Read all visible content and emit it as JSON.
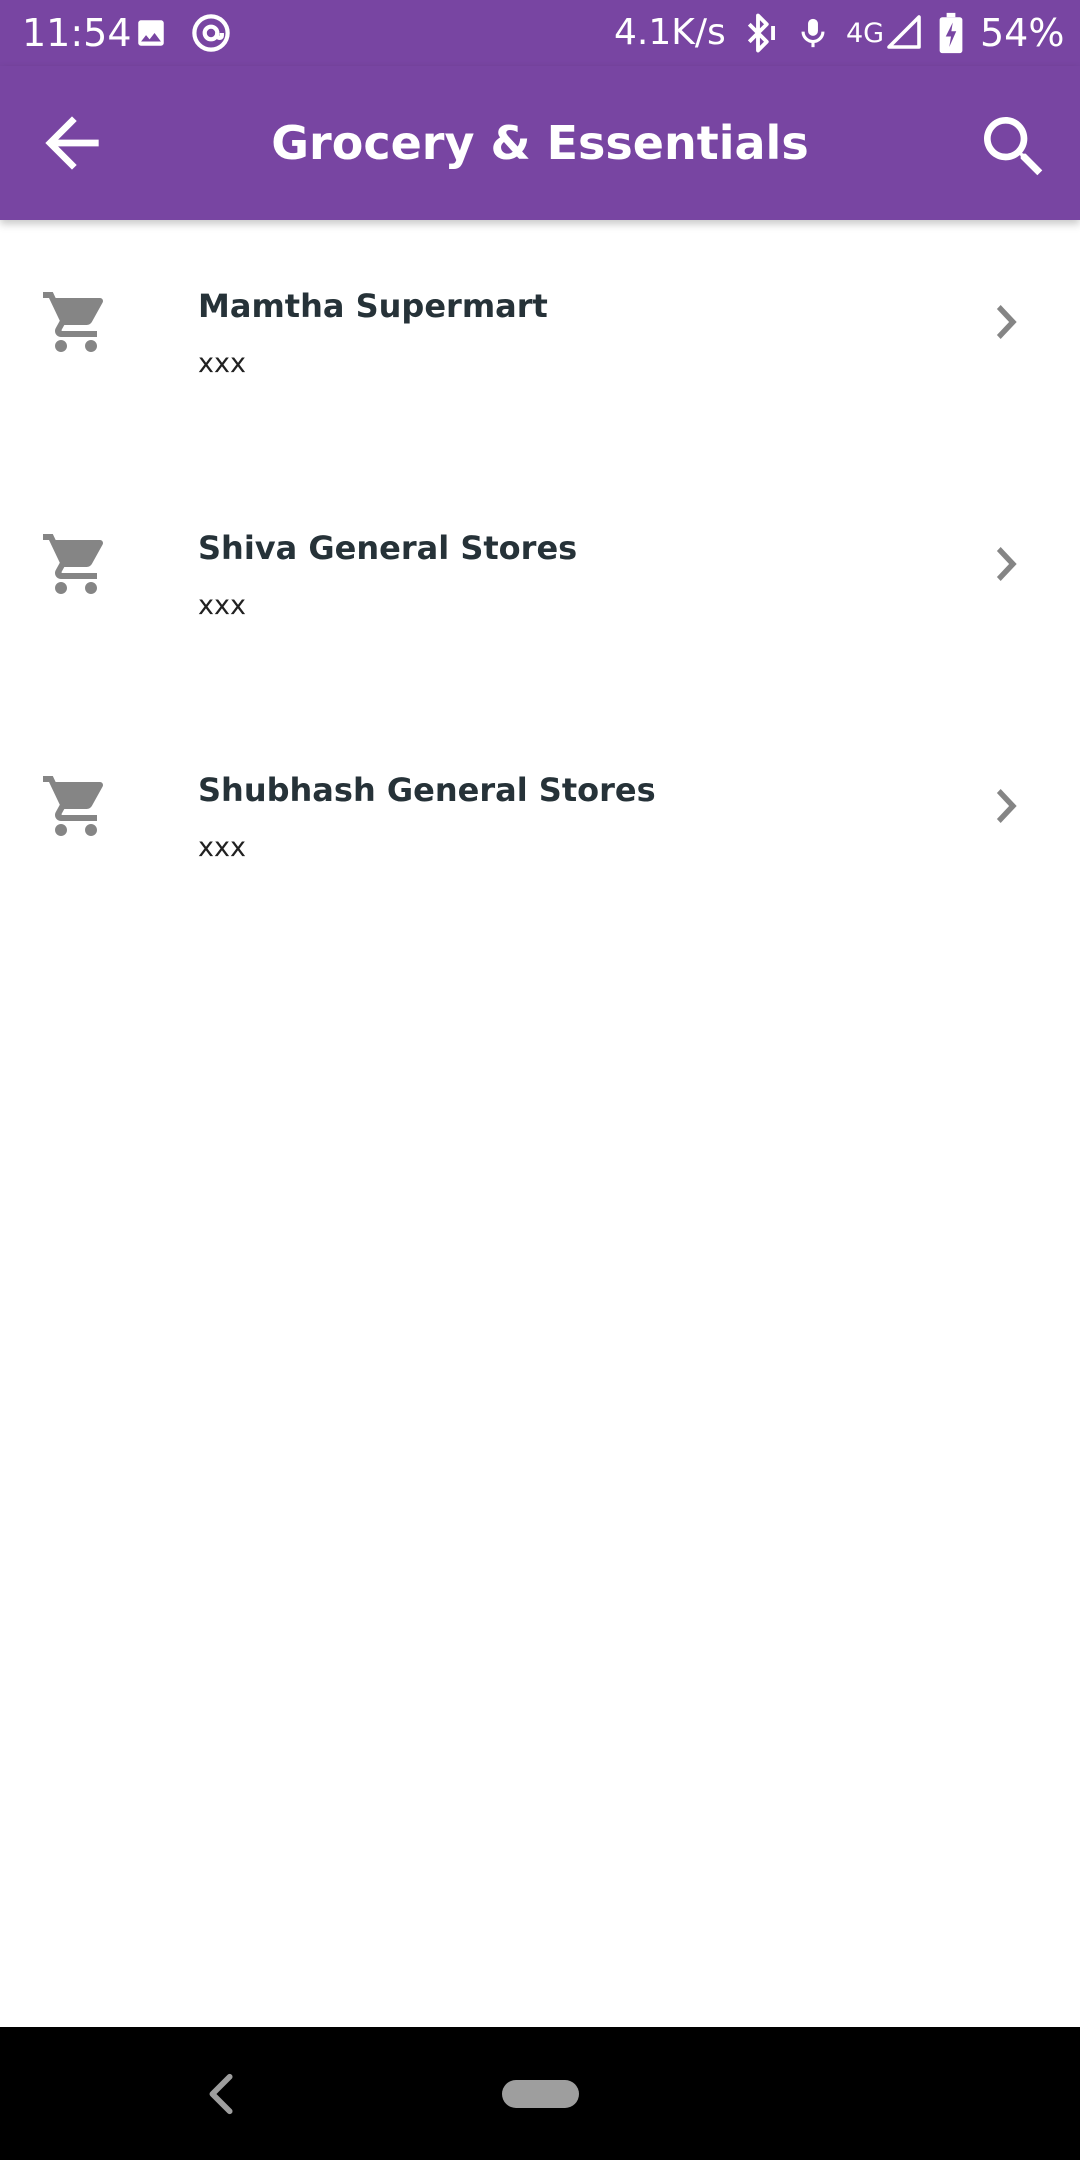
{
  "status_bar": {
    "time": "11:54",
    "network_speed": "4.1K/s",
    "network_type": "4G",
    "battery": "54%",
    "icons": [
      "image-icon",
      "at-sign-icon",
      "bluetooth-icon",
      "microphone-icon",
      "signal-icon",
      "battery-charging-icon"
    ]
  },
  "app_bar": {
    "title": "Grocery & Essentials",
    "back_icon": "arrow-back-icon",
    "search_icon": "search-icon"
  },
  "stores": [
    {
      "name": "Mamtha Supermart",
      "subtitle": "xxx",
      "icon": "cart-icon"
    },
    {
      "name": "Shiva General Stores",
      "subtitle": "xxx",
      "icon": "cart-icon"
    },
    {
      "name": "Shubhash General Stores",
      "subtitle": "xxx",
      "icon": "cart-icon"
    }
  ],
  "navigation_bar": {
    "icons": [
      "nav-back-icon",
      "nav-home-pill"
    ]
  },
  "colors": {
    "primary": "#7845A2",
    "icon_grey": "#858585",
    "title_text": "#263238"
  }
}
